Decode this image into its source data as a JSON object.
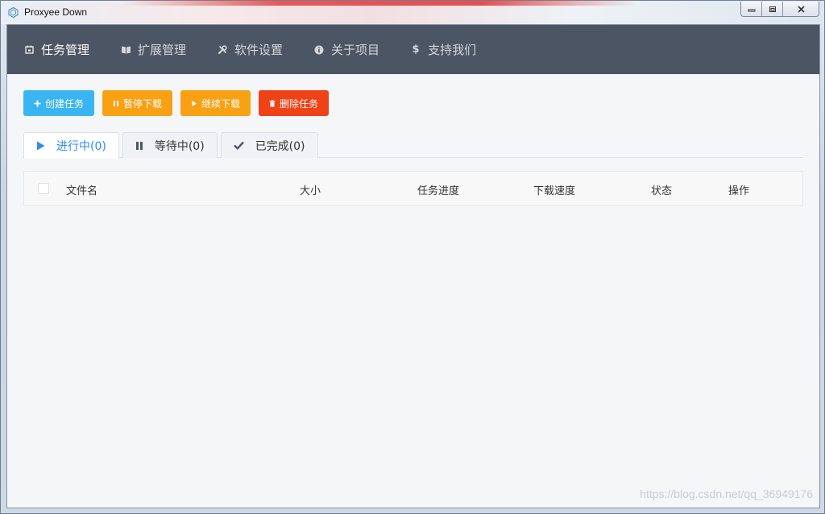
{
  "window": {
    "title": "Proxyee Down",
    "controls": {
      "minimize_icon": "minimize-icon",
      "restore_icon": "restore-icon",
      "close_icon": "close-icon"
    }
  },
  "nav": {
    "items": [
      {
        "label": "任务管理",
        "icon": "task-icon",
        "active": true
      },
      {
        "label": "扩展管理",
        "icon": "book-icon",
        "active": false
      },
      {
        "label": "软件设置",
        "icon": "tools-icon",
        "active": false
      },
      {
        "label": "关于项目",
        "icon": "info-icon",
        "active": false
      },
      {
        "label": "支持我们",
        "icon": "dollar-icon",
        "active": false
      }
    ]
  },
  "toolbar": {
    "create_label": "创建任务",
    "pause_label": "暂停下载",
    "resume_label": "继续下载",
    "delete_label": "删除任务"
  },
  "tabs": [
    {
      "label": "进行中(0)",
      "active": true
    },
    {
      "label": "等待中(0)",
      "active": false
    },
    {
      "label": "已完成(0)",
      "active": false
    }
  ],
  "table": {
    "columns": [
      "文件名",
      "大小",
      "任务进度",
      "下载速度",
      "状态",
      "操作"
    ],
    "rows": []
  },
  "watermark": "https://blog.csdn.net/qq_36949176",
  "colors": {
    "nav_bg": "#4c5564",
    "primary": "#39b6f1",
    "warning": "#f8a114",
    "danger": "#ef4217",
    "tab_active": "#2d8cf0"
  }
}
